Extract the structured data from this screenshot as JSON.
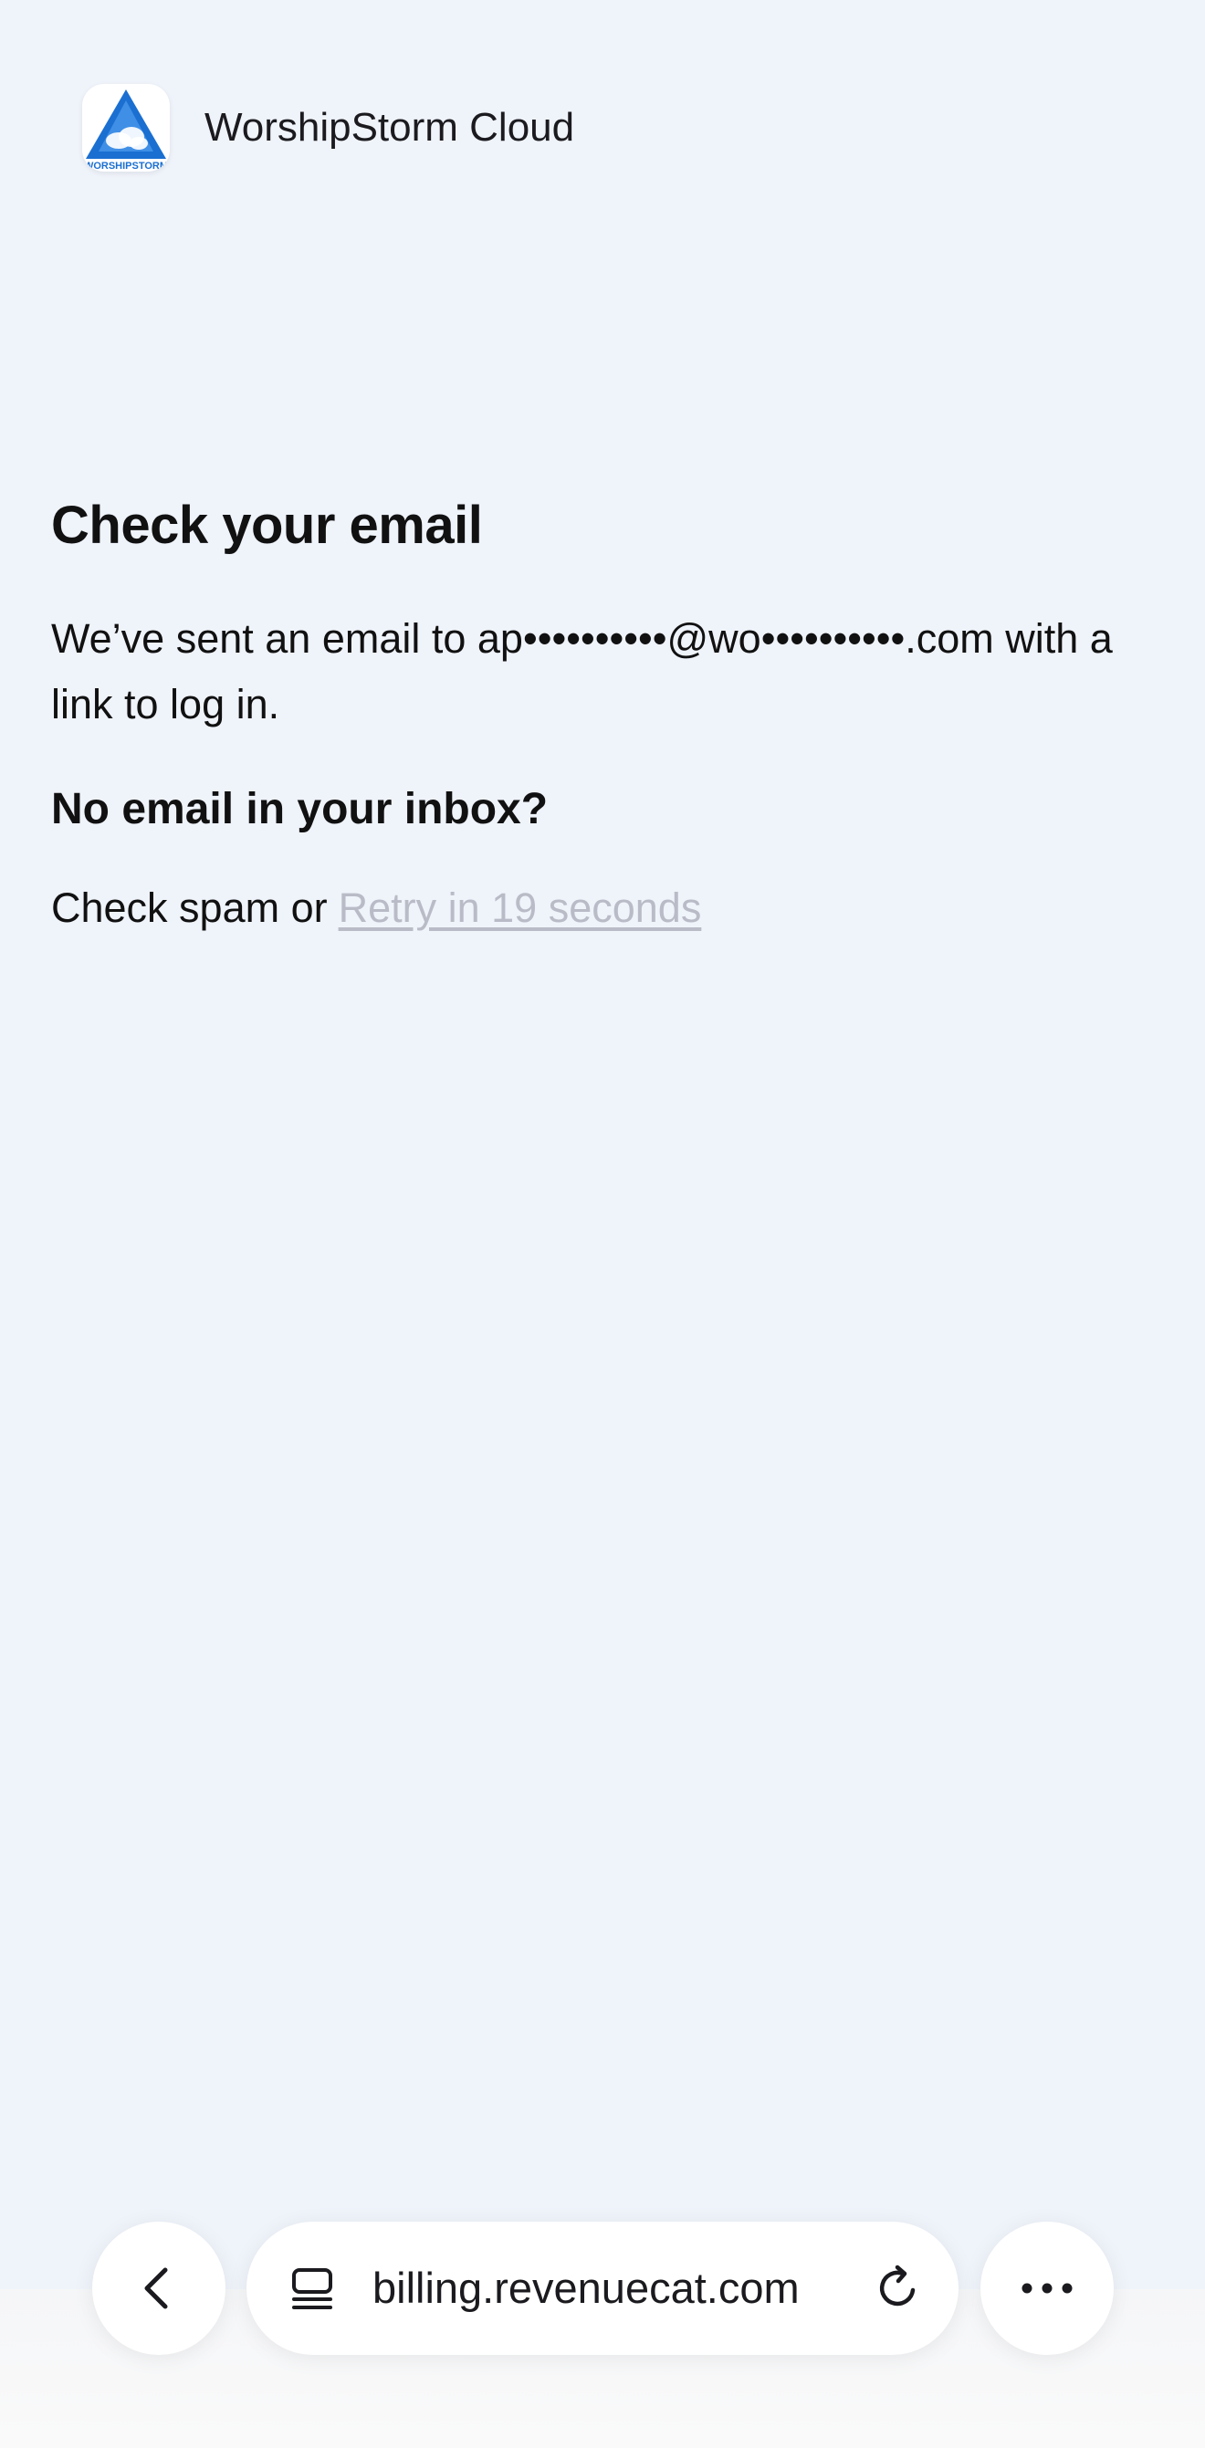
{
  "header": {
    "app_title": "WorshipStorm Cloud",
    "logo_text": "WORSHIPSTORM"
  },
  "main": {
    "heading": "Check your email",
    "message": "We’ve sent an email to ap••••••••••@wo••••••••••.com with a link to log in.",
    "subheading": "No email in your inbox?",
    "spam_prefix": "Check spam or",
    "retry_label": "Retry in 19 seconds"
  },
  "browser": {
    "url": "billing.revenuecat.com",
    "icons": [
      "back-chevron-icon",
      "tabs-icon",
      "reload-icon",
      "more-dots-icon"
    ]
  },
  "colors": {
    "background": "#eff3fa",
    "logo_blue": "#1a6fd1",
    "retry_disabled": "#b9bcc6"
  }
}
